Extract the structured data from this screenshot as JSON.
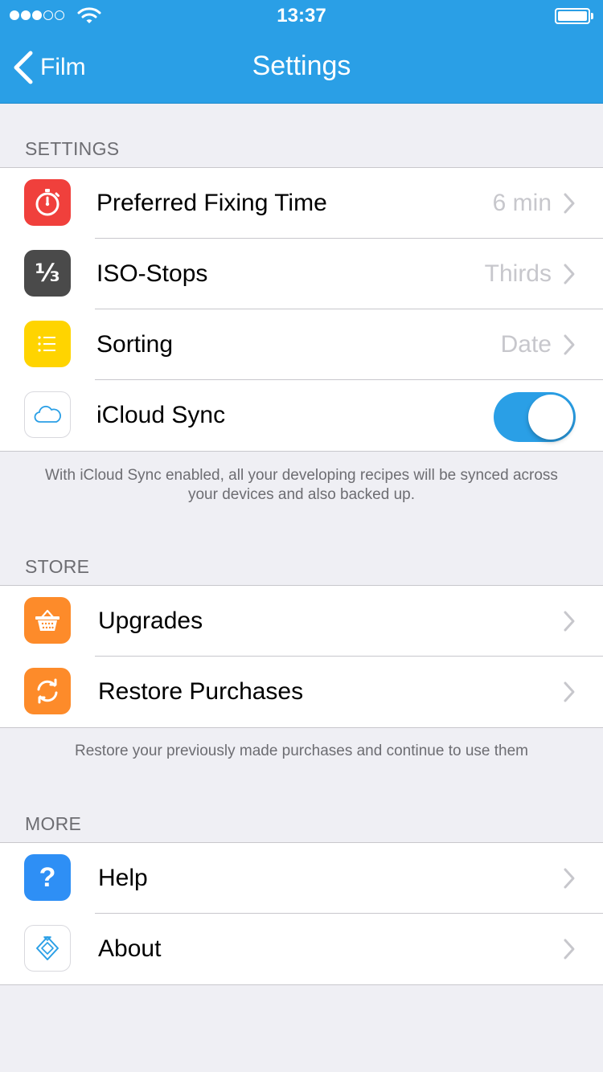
{
  "status_bar": {
    "time": "13:37"
  },
  "nav": {
    "back_label": "Film",
    "title": "Settings"
  },
  "sections": {
    "settings": {
      "header": "SETTINGS",
      "rows": {
        "fixing": {
          "label": "Preferred Fixing Time",
          "value": "6 min",
          "icon": "stopwatch-icon",
          "icon_color": "#f0403c"
        },
        "iso": {
          "label": "ISO-Stops",
          "value": "Thirds",
          "icon": "one-third-icon",
          "icon_glyph": "⅓",
          "icon_color": "#4a4a4a"
        },
        "sorting": {
          "label": "Sorting",
          "value": "Date",
          "icon": "list-icon",
          "icon_color": "#ffd400"
        },
        "icloud": {
          "label": "iCloud Sync",
          "icon": "cloud-icon",
          "toggle_on": true
        }
      },
      "footer": "With iCloud Sync enabled, all your developing recipes will be synced across your devices and also backed up."
    },
    "store": {
      "header": "STORE",
      "rows": {
        "upgrades": {
          "label": "Upgrades",
          "icon": "basket-icon",
          "icon_color": "#fd8b2a"
        },
        "restore": {
          "label": "Restore Purchases",
          "icon": "refresh-icon",
          "icon_color": "#fd8b2a"
        }
      },
      "footer": "Restore your previously made purchases and continue to use them"
    },
    "more": {
      "header": "MORE",
      "rows": {
        "help": {
          "label": "Help",
          "icon": "question-icon",
          "icon_glyph": "?",
          "icon_color": "#2e8ff5"
        },
        "about": {
          "label": "About",
          "icon": "app-logo-icon"
        }
      }
    }
  },
  "colors": {
    "accent": "#2a9fe6",
    "background": "#efeff4"
  }
}
